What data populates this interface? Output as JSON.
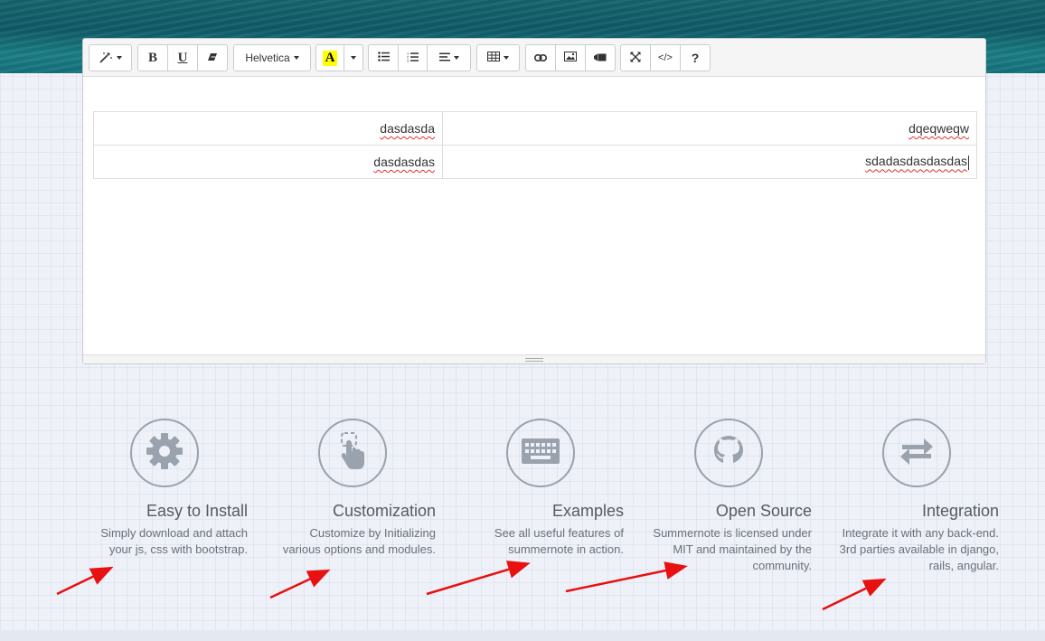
{
  "toolbar": {
    "style_icon": "magic-wand-icon",
    "bold_label": "B",
    "underline_label": "U",
    "clear_format_icon": "eraser-icon",
    "font_name": "Helvetica",
    "color_label": "A",
    "color_highlight": "#ffff00",
    "unordered_list_icon": "unordered-list-icon",
    "ordered_list_icon": "ordered-list-icon",
    "paragraph_icon": "align-left-icon",
    "table_icon": "table-icon",
    "link_icon": "link-icon",
    "picture_icon": "picture-icon",
    "video_icon": "video-icon",
    "fullscreen_icon": "fullscreen-icon",
    "codeview_label": "</>",
    "help_label": "?"
  },
  "editor_table": {
    "rows": [
      [
        "dasdasda",
        "dqeqweqw"
      ],
      [
        "dasdasdas",
        "sdadasdasdasdas"
      ]
    ]
  },
  "features": [
    {
      "icon": "gear-icon",
      "title": "Easy to Install",
      "desc": "Simply download and attach your js, css with bootstrap."
    },
    {
      "icon": "touch-icon",
      "title": "Customization",
      "desc": "Customize by Initializing various options and modules."
    },
    {
      "icon": "keyboard-icon",
      "title": "Examples",
      "desc": "See all useful features of summernote in action."
    },
    {
      "icon": "github-icon",
      "title": "Open Source",
      "desc": "Summernote is licensed under MIT and maintained by the community."
    },
    {
      "icon": "exchange-icon",
      "title": "Integration",
      "desc": "Integrate it with any back-end. 3rd parties available in django, rails, angular."
    }
  ],
  "colors": {
    "accent_arrow": "#e81010",
    "icon_gray": "#9aa2ad",
    "hero_water": "#0f5a66"
  }
}
